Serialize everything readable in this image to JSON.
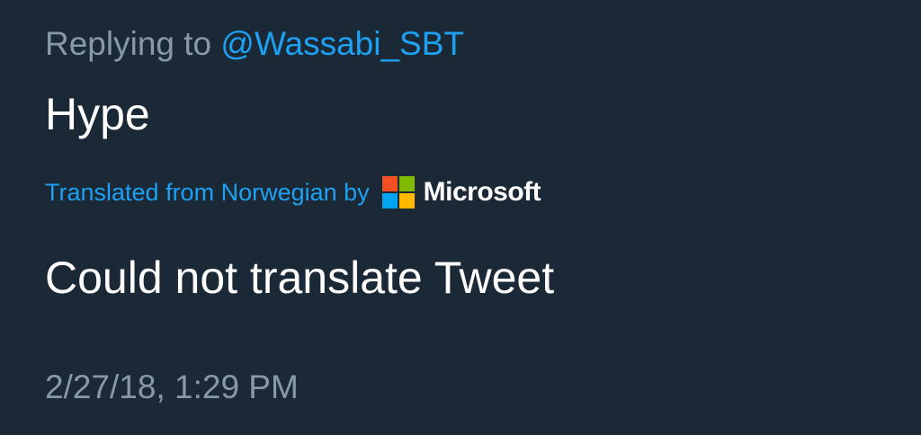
{
  "tweet": {
    "replying_prefix": "Replying to",
    "reply_handle": "@Wassabi_SBT",
    "text": "Hype",
    "translation": {
      "label": "Translated from Norwegian by",
      "provider": "Microsoft",
      "provider_logo": "microsoft-logo-icon",
      "logo_colors": [
        "#f25022",
        "#7fba00",
        "#00a4ef",
        "#ffb900"
      ],
      "result": "Could not translate Tweet"
    },
    "timestamp": "2/27/18, 1:29 PM"
  },
  "colors": {
    "background": "#1b2836",
    "accent": "#1da1f2",
    "muted": "#8899a6",
    "text": "#ffffff"
  }
}
